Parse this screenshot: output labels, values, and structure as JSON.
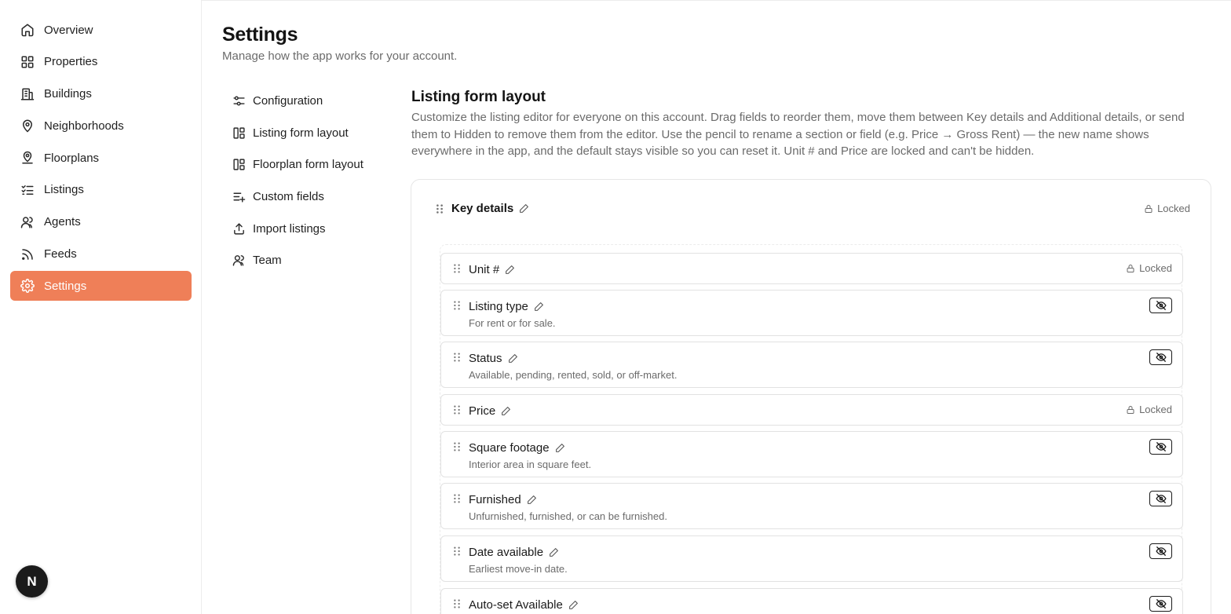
{
  "sidebar": {
    "items": [
      {
        "label": "Overview",
        "icon": "home-icon"
      },
      {
        "label": "Properties",
        "icon": "grid-icon"
      },
      {
        "label": "Buildings",
        "icon": "building-icon"
      },
      {
        "label": "Neighborhoods",
        "icon": "map-pin-icon"
      },
      {
        "label": "Floorplans",
        "icon": "user-pin-icon"
      },
      {
        "label": "Listings",
        "icon": "list-check-icon"
      },
      {
        "label": "Agents",
        "icon": "users-icon"
      },
      {
        "label": "Feeds",
        "icon": "rss-icon"
      },
      {
        "label": "Settings",
        "icon": "gear-icon",
        "active": true
      }
    ],
    "badge": "N"
  },
  "header": {
    "title": "Settings",
    "subtitle": "Manage how the app works for your account."
  },
  "subnav": {
    "items": [
      {
        "label": "Configuration",
        "icon": "sliders-icon"
      },
      {
        "label": "Listing form layout",
        "icon": "layout-icon"
      },
      {
        "label": "Floorplan form layout",
        "icon": "layout-icon"
      },
      {
        "label": "Custom fields",
        "icon": "list-plus-icon"
      },
      {
        "label": "Import listings",
        "icon": "upload-icon"
      },
      {
        "label": "Team",
        "icon": "users-icon"
      }
    ]
  },
  "content": {
    "title": "Listing form layout",
    "description": "Customize the listing editor for everyone on this account. Drag fields to reorder them, move them between Key details and Additional details, or send them to Hidden to remove them from the editor. Use the pencil to rename a section or field (e.g. Price → Gross Rent) — the new name shows everywhere in the app, and the default stays visible so you can reset it. Unit # and Price are locked and can't be hidden.",
    "section": {
      "title": "Key details",
      "lock_label": "Locked"
    },
    "fields": [
      {
        "name": "Unit #",
        "desc": "",
        "locked": true,
        "lock_label": "Locked"
      },
      {
        "name": "Listing type",
        "desc": "For rent or for sale.",
        "locked": false
      },
      {
        "name": "Status",
        "desc": "Available, pending, rented, sold, or off-market.",
        "locked": false
      },
      {
        "name": "Price",
        "desc": "",
        "locked": true,
        "lock_label": "Locked"
      },
      {
        "name": "Square footage",
        "desc": "Interior area in square feet.",
        "locked": false
      },
      {
        "name": "Furnished",
        "desc": "Unfurnished, furnished, or can be furnished.",
        "locked": false
      },
      {
        "name": "Date available",
        "desc": "Earliest move-in date.",
        "locked": false
      },
      {
        "name": "Auto-set Available",
        "desc": "",
        "locked": false
      }
    ]
  },
  "colors": {
    "accent": "#ef7f58"
  }
}
